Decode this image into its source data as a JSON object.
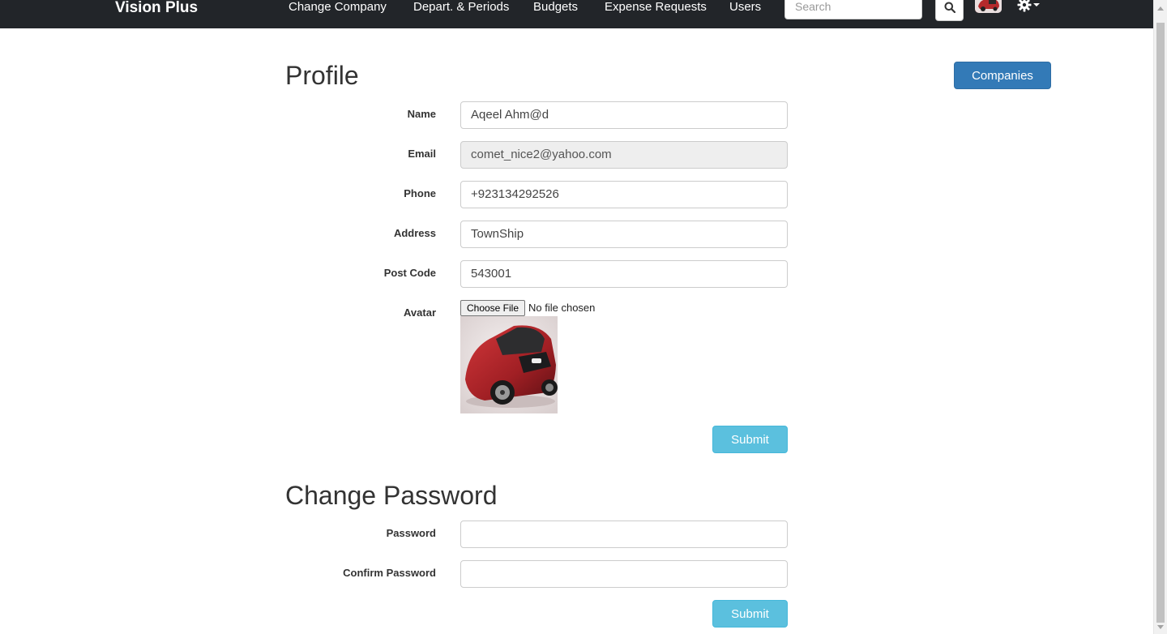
{
  "navbar": {
    "brand": "Vision Plus",
    "links": [
      "Change Company",
      "Depart. & Periods",
      "Budgets",
      "Expense Requests",
      "Users"
    ],
    "search_placeholder": "Search"
  },
  "profile": {
    "title": "Profile",
    "companies_button": "Companies",
    "fields": {
      "name": {
        "label": "Name",
        "value": "Aqeel Ahm@d"
      },
      "email": {
        "label": "Email",
        "value": "comet_nice2@yahoo.com"
      },
      "phone": {
        "label": "Phone",
        "value": "+923134292526"
      },
      "address": {
        "label": "Address",
        "value": "TownShip"
      },
      "post_code": {
        "label": "Post Code",
        "value": "543001"
      }
    },
    "avatar": {
      "label": "Avatar",
      "choose_file": "Choose File",
      "file_status": "No file chosen"
    },
    "submit": "Submit"
  },
  "change_password": {
    "title": "Change Password",
    "password_label": "Password",
    "confirm_label": "Confirm Password",
    "submit": "Submit"
  },
  "colors": {
    "navbar_bg": "#222529",
    "primary": "#337ab7",
    "info": "#5bc0de"
  },
  "icons": [
    "search-icon",
    "gear-icon",
    "caret-down-icon"
  ]
}
